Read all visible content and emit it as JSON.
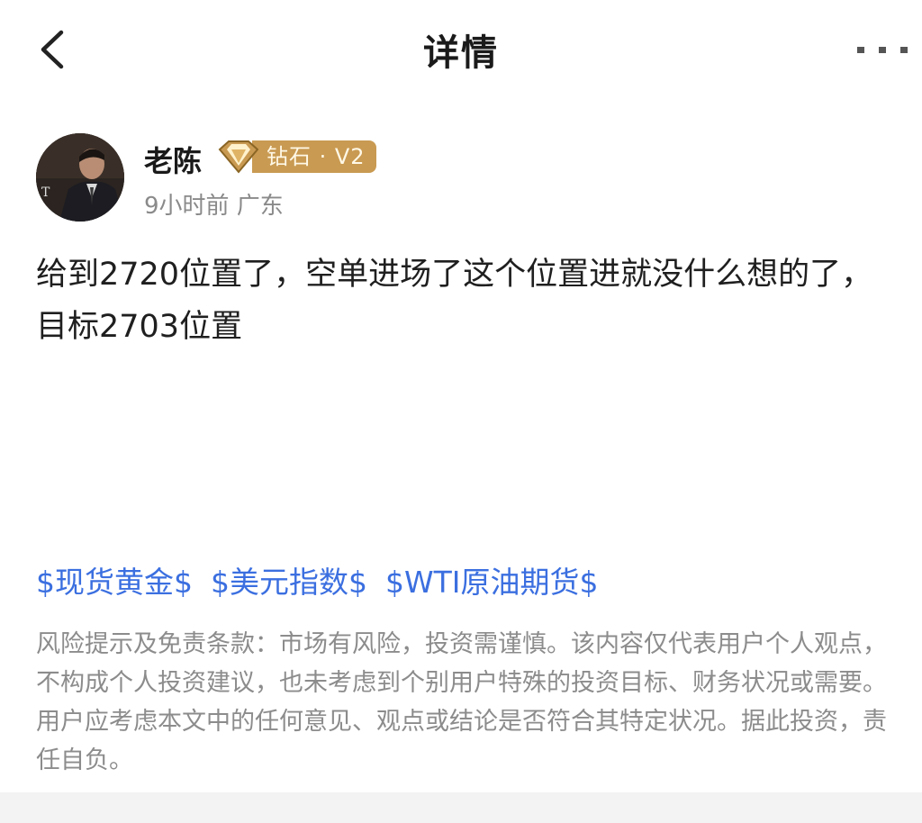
{
  "header": {
    "title": "详情",
    "back_icon": "chevron-left-icon",
    "more_icon": "more-dots-icon"
  },
  "author": {
    "name": "老陈",
    "badge": {
      "icon": "diamond-icon",
      "label": "钻石 · V2",
      "color": "#c99a52"
    },
    "meta": "9小时前 广东"
  },
  "post": {
    "text": "给到2720位置了，空单进场了这个位置进就没什么想的了，目标2703位置"
  },
  "tags": [
    "$现货黄金$",
    "$美元指数$",
    "$WTI原油期货$"
  ],
  "disclaimer": "风险提示及免责条款：市场有风险，投资需谨慎。该内容仅代表用户个人观点，不构成个人投资建议，也未考虑到个别用户特殊的投资目标、财务状况或需要。用户应考虑本文中的任何意见、观点或结论是否符合其特定状况。据此投资，责任自负。",
  "colors": {
    "link": "#3b6fe0",
    "muted": "#8c8c8c",
    "badge_gold": "#c99a52"
  }
}
